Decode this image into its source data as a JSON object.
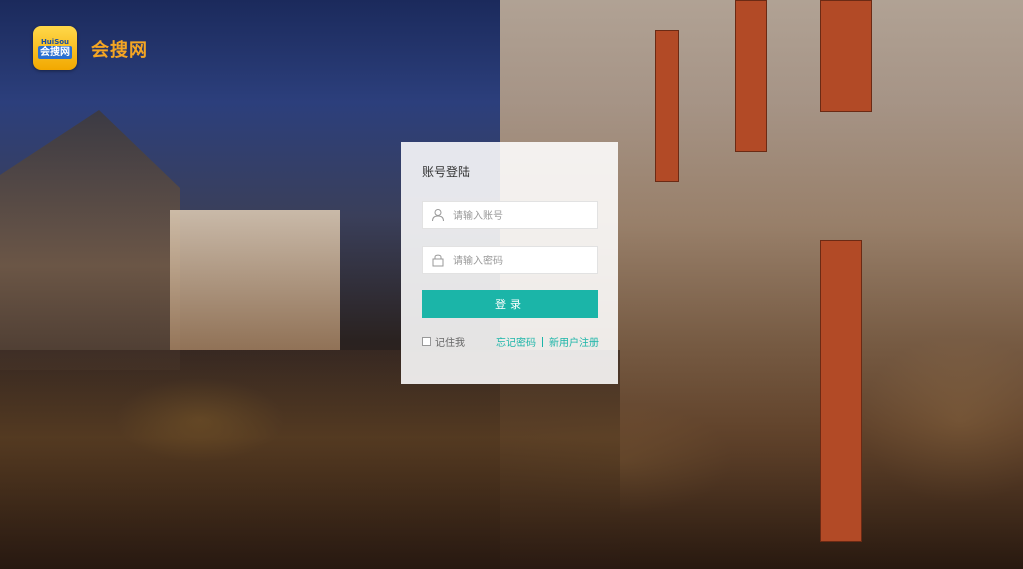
{
  "brand": {
    "logo_top": "HuiSou",
    "logo_bottom": "会搜网",
    "name": "会搜网"
  },
  "login": {
    "title": "账号登陆",
    "username_placeholder": "请输入账号",
    "password_placeholder": "请输入密码",
    "submit_label": "登录",
    "remember_label": "记住我",
    "forgot_label": "忘记密码",
    "register_label": "新用户注册"
  },
  "colors": {
    "accent": "#1bb5a8",
    "brand": "#f5a623"
  },
  "icons": {
    "username": "user-icon",
    "password": "lock-icon"
  }
}
